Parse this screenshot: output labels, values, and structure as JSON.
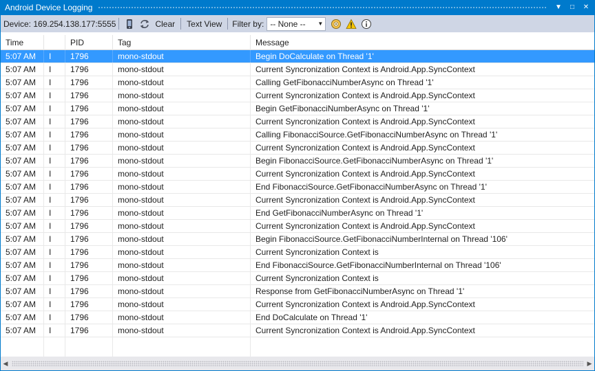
{
  "window": {
    "title": "Android Device Logging",
    "buttons": {
      "dropdown": "▼",
      "maximize": "□",
      "close": "✕"
    }
  },
  "toolbar": {
    "device_label": "Device: 169.254.138.177:5555",
    "clear_label": "Clear",
    "text_view_label": "Text View",
    "filter_label": "Filter by:",
    "filter_value": "-- None --",
    "icons": [
      "device-icon",
      "refresh-icon",
      "error-filter-icon",
      "warning-filter-icon",
      "info-filter-icon"
    ]
  },
  "columns": {
    "time": "Time",
    "level": "",
    "pid": "PID",
    "tag": "Tag",
    "message": "Message"
  },
  "colors": {
    "accent": "#007acc",
    "selection": "#3399ff",
    "toolbar": "#cfd6e5"
  },
  "rows": [
    {
      "time": "5:07 AM",
      "level": "I",
      "pid": "1796",
      "tag": "mono-stdout",
      "message": "Begin DoCalculate on Thread '1'",
      "selected": true
    },
    {
      "time": "5:07 AM",
      "level": "I",
      "pid": "1796",
      "tag": "mono-stdout",
      "message": "Current Syncronization Context is Android.App.SyncContext"
    },
    {
      "time": "5:07 AM",
      "level": "I",
      "pid": "1796",
      "tag": "mono-stdout",
      "message": "Calling GetFibonacciNumberAsync on Thread '1'"
    },
    {
      "time": "5:07 AM",
      "level": "I",
      "pid": "1796",
      "tag": "mono-stdout",
      "message": "Current Syncronization Context is Android.App.SyncContext"
    },
    {
      "time": "5:07 AM",
      "level": "I",
      "pid": "1796",
      "tag": "mono-stdout",
      "message": "Begin GetFibonacciNumberAsync on Thread '1'"
    },
    {
      "time": "5:07 AM",
      "level": "I",
      "pid": "1796",
      "tag": "mono-stdout",
      "message": "Current Syncronization Context is Android.App.SyncContext"
    },
    {
      "time": "5:07 AM",
      "level": "I",
      "pid": "1796",
      "tag": "mono-stdout",
      "message": "Calling FibonacciSource.GetFibonacciNumberAsync on Thread '1'"
    },
    {
      "time": "5:07 AM",
      "level": "I",
      "pid": "1796",
      "tag": "mono-stdout",
      "message": "Current Syncronization Context is Android.App.SyncContext"
    },
    {
      "time": "5:07 AM",
      "level": "I",
      "pid": "1796",
      "tag": "mono-stdout",
      "message": "Begin FibonacciSource.GetFibonacciNumberAsync on Thread '1'"
    },
    {
      "time": "5:07 AM",
      "level": "I",
      "pid": "1796",
      "tag": "mono-stdout",
      "message": "Current Syncronization Context is Android.App.SyncContext"
    },
    {
      "time": "5:07 AM",
      "level": "I",
      "pid": "1796",
      "tag": "mono-stdout",
      "message": "End FibonacciSource.GetFibonacciNumberAsync on Thread '1'"
    },
    {
      "time": "5:07 AM",
      "level": "I",
      "pid": "1796",
      "tag": "mono-stdout",
      "message": "Current Syncronization Context is Android.App.SyncContext"
    },
    {
      "time": "5:07 AM",
      "level": "I",
      "pid": "1796",
      "tag": "mono-stdout",
      "message": "End GetFibonacciNumberAsync on Thread '1'"
    },
    {
      "time": "5:07 AM",
      "level": "I",
      "pid": "1796",
      "tag": "mono-stdout",
      "message": "Current Syncronization Context is Android.App.SyncContext"
    },
    {
      "time": "5:07 AM",
      "level": "I",
      "pid": "1796",
      "tag": "mono-stdout",
      "message": "Begin FibonacciSource.GetFibonacciNumberInternal on Thread '106'"
    },
    {
      "time": "5:07 AM",
      "level": "I",
      "pid": "1796",
      "tag": "mono-stdout",
      "message": "Current Syncronization Context is"
    },
    {
      "time": "5:07 AM",
      "level": "I",
      "pid": "1796",
      "tag": "mono-stdout",
      "message": "End FibonacciSource.GetFibonacciNumberInternal on Thread '106'"
    },
    {
      "time": "5:07 AM",
      "level": "I",
      "pid": "1796",
      "tag": "mono-stdout",
      "message": "Current Syncronization Context is"
    },
    {
      "time": "5:07 AM",
      "level": "I",
      "pid": "1796",
      "tag": "mono-stdout",
      "message": "Response from GetFibonacciNumberAsync on Thread '1'"
    },
    {
      "time": "5:07 AM",
      "level": "I",
      "pid": "1796",
      "tag": "mono-stdout",
      "message": "Current Syncronization Context is Android.App.SyncContext"
    },
    {
      "time": "5:07 AM",
      "level": "I",
      "pid": "1796",
      "tag": "mono-stdout",
      "message": "End DoCalculate on Thread '1'"
    },
    {
      "time": "5:07 AM",
      "level": "I",
      "pid": "1796",
      "tag": "mono-stdout",
      "message": "Current Syncronization Context is Android.App.SyncContext"
    }
  ]
}
